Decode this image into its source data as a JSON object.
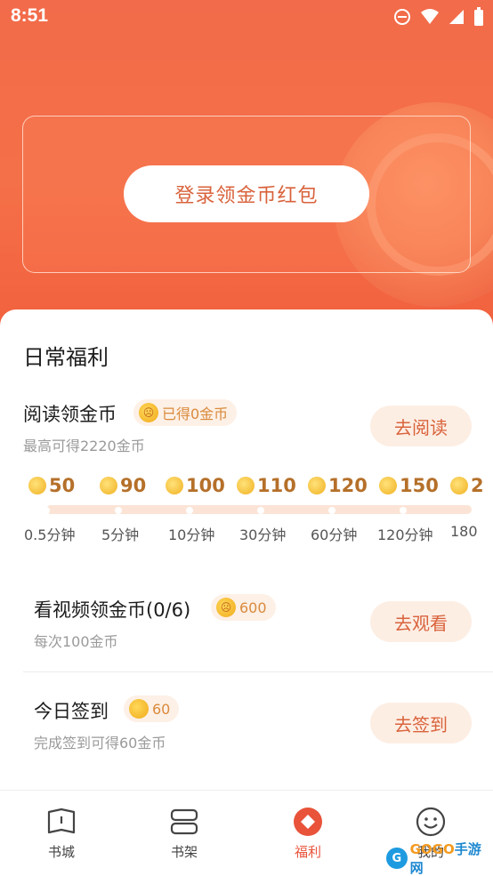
{
  "status_bar": {
    "time": "8:51"
  },
  "hero": {
    "login_button": "登录领金币红包"
  },
  "daily": {
    "title": "日常福利",
    "reading": {
      "title": "阅读领金币",
      "earned_chip": "已得0金币",
      "subtitle": "最高可得2220金币",
      "button": "去阅读",
      "milestones": [
        {
          "coins": "50",
          "label": "0.5分钟"
        },
        {
          "coins": "90",
          "label": "5分钟"
        },
        {
          "coins": "100",
          "label": "10分钟"
        },
        {
          "coins": "110",
          "label": "30分钟"
        },
        {
          "coins": "120",
          "label": "60分钟"
        },
        {
          "coins": "150",
          "label": "120分钟"
        },
        {
          "coins": "2",
          "label": "180"
        }
      ]
    },
    "video": {
      "title": "看视频领金币(0/6)",
      "chip": "600",
      "subtitle": "每次100金币",
      "button": "去观看"
    },
    "checkin": {
      "title": "今日签到",
      "chip": "60",
      "subtitle": "完成签到可得60金币",
      "button": "去签到"
    }
  },
  "tabbar": {
    "items": [
      {
        "label": "书城",
        "icon": "book-icon"
      },
      {
        "label": "书架",
        "icon": "bookshelf-icon"
      },
      {
        "label": "福利",
        "icon": "welfare-icon",
        "active": true
      },
      {
        "label": "我的",
        "icon": "smiley-icon"
      }
    ]
  },
  "watermark": {
    "logo": "G",
    "brand_a": "GOGO",
    "brand_b": "手游网"
  },
  "colors": {
    "accent": "#e8533a",
    "hero": "#f26b4a",
    "coin": "#f0b020"
  }
}
